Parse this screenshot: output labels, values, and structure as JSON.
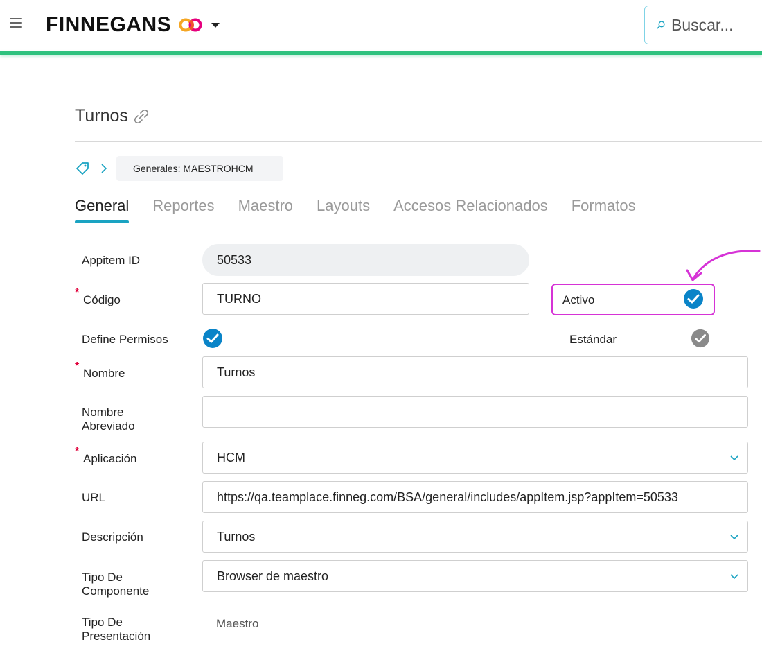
{
  "header": {
    "brand": "FINNEGANS",
    "search_placeholder": "Buscar..."
  },
  "page": {
    "title": "Turnos",
    "breadcrumb": "Generales: MAESTROHCM"
  },
  "tabs": [
    {
      "label": "General",
      "active": true
    },
    {
      "label": "Reportes",
      "active": false
    },
    {
      "label": "Maestro",
      "active": false
    },
    {
      "label": "Layouts",
      "active": false
    },
    {
      "label": "Accesos Relacionados",
      "active": false
    },
    {
      "label": "Formatos",
      "active": false
    }
  ],
  "form": {
    "appitem_id": {
      "label": "Appitem ID",
      "value": "50533"
    },
    "codigo": {
      "label": "Código",
      "value": "TURNO",
      "required": true
    },
    "activo": {
      "label": "Activo",
      "checked": true
    },
    "define_permisos": {
      "label": "Define Permisos",
      "checked": true
    },
    "estandar": {
      "label": "Estándar",
      "checked": true,
      "disabled": true
    },
    "nombre": {
      "label": "Nombre",
      "value": "Turnos",
      "required": true
    },
    "nombre_abreviado": {
      "label_line1": "Nombre",
      "label_line2": "Abreviado",
      "value": ""
    },
    "aplicacion": {
      "label": "Aplicación",
      "value": "HCM",
      "required": true
    },
    "url": {
      "label": "URL",
      "value": "https://qa.teamplace.finneg.com/BSA/general/includes/appItem.jsp?appItem=50533"
    },
    "descripcion": {
      "label": "Descripción",
      "value": "Turnos"
    },
    "tipo_componente": {
      "label_line1": "Tipo De",
      "label_line2": "Componente",
      "value": "Browser de maestro"
    },
    "tipo_presentacion": {
      "label_line1": "Tipo De",
      "label_line2": "Presentación",
      "value": "Maestro"
    }
  },
  "colors": {
    "accent_green": "#2ec27e",
    "tab_underline": "#1aa3c2",
    "check_blue": "#0a84c8",
    "check_gray": "#8a8a8a",
    "required_star": "#e0003a",
    "annotation_magenta": "#d633d6"
  },
  "icons": {
    "menu": "hamburger-icon",
    "logo": "finnegans-infinity-logo",
    "search": "search-icon",
    "link": "link-icon",
    "tag": "tag-icon",
    "checkbox": "check-circle-icon",
    "select": "chevron-down-icon"
  }
}
